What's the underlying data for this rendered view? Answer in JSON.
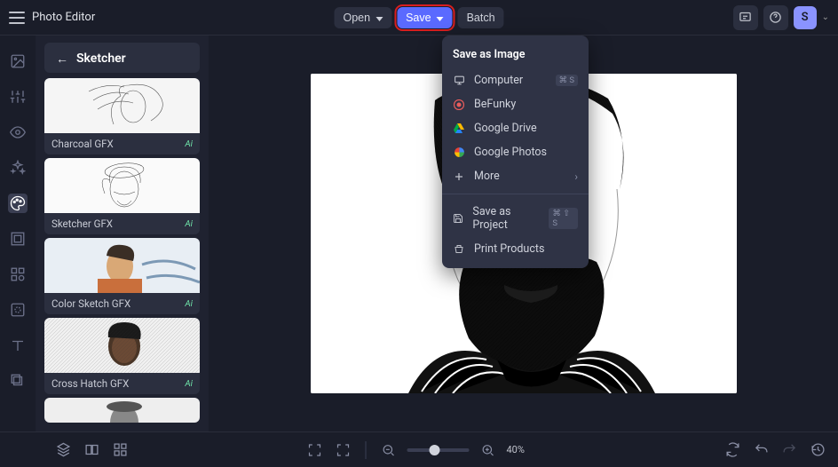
{
  "header": {
    "app_title": "Photo Editor",
    "open_label": "Open",
    "save_label": "Save",
    "batch_label": "Batch",
    "avatar_letter": "S"
  },
  "sidebar": {
    "title": "Sketcher",
    "effects": [
      {
        "label": "Charcoal GFX",
        "ai": "Ai"
      },
      {
        "label": "Sketcher GFX",
        "ai": "Ai"
      },
      {
        "label": "Color Sketch GFX",
        "ai": "Ai"
      },
      {
        "label": "Cross Hatch GFX",
        "ai": "Ai"
      }
    ]
  },
  "save_menu": {
    "header": "Save as Image",
    "items": [
      {
        "label": "Computer",
        "icon": "monitor-icon",
        "shortcut": "⌘ S"
      },
      {
        "label": "BeFunky",
        "icon": "befunky-icon"
      },
      {
        "label": "Google Drive",
        "icon": "gdrive-icon"
      },
      {
        "label": "Google Photos",
        "icon": "gphotos-icon"
      },
      {
        "label": "More",
        "icon": "plus-icon",
        "chevron": true
      }
    ],
    "project": {
      "label": "Save as Project",
      "icon": "save-project-icon",
      "shortcut": "⌘ ⇧ S"
    },
    "print": {
      "label": "Print Products",
      "icon": "print-icon"
    }
  },
  "bottom": {
    "zoom_pct": "40%"
  }
}
